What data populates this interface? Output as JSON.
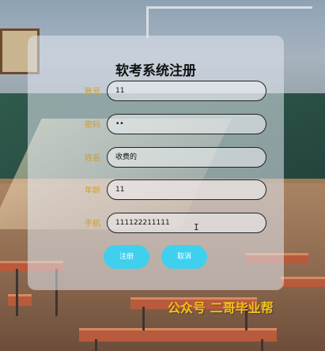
{
  "form": {
    "title": "软考系统注册",
    "fields": [
      {
        "label": "账号",
        "value": "11"
      },
      {
        "label": "密码",
        "value": "••"
      },
      {
        "label": "姓名",
        "value": "收费的"
      },
      {
        "label": "年龄",
        "value": "11"
      },
      {
        "label": "手机",
        "value": "111122211111"
      }
    ],
    "register_label": "注册",
    "cancel_label": "取消"
  },
  "cursor_glyph": "I",
  "watermark": "公众号 二哥毕业帮",
  "colors": {
    "label": "#d49a2a",
    "button": "#3fd0ee",
    "watermark": "#f2c21b"
  }
}
